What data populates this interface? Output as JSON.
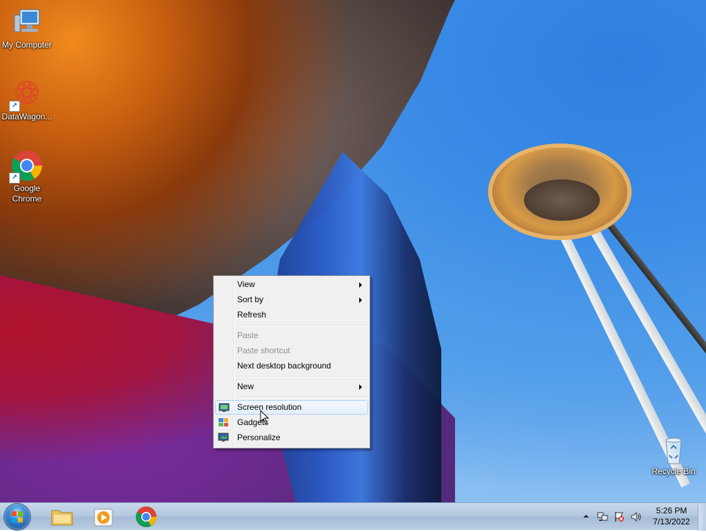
{
  "desktop": {
    "icons": [
      {
        "label": "My Computer",
        "icon": "computer-icon"
      },
      {
        "label": "DataWagon...",
        "icon": "datawagon-icon"
      },
      {
        "label": "Google Chrome",
        "icon": "chrome-icon"
      },
      {
        "label": "Recycle Bin",
        "icon": "recycle-bin-icon"
      }
    ]
  },
  "context_menu": {
    "items": [
      {
        "label": "View",
        "submenu": true,
        "enabled": true
      },
      {
        "label": "Sort by",
        "submenu": true,
        "enabled": true
      },
      {
        "label": "Refresh",
        "submenu": false,
        "enabled": true
      },
      {
        "label": "Paste",
        "submenu": false,
        "enabled": false
      },
      {
        "label": "Paste shortcut",
        "submenu": false,
        "enabled": false
      },
      {
        "label": "Next desktop background",
        "submenu": false,
        "enabled": true
      },
      {
        "label": "New",
        "submenu": true,
        "enabled": true
      },
      {
        "label": "Screen resolution",
        "submenu": false,
        "enabled": true,
        "highlighted": true,
        "icon": "display-icon"
      },
      {
        "label": "Gadgets",
        "submenu": false,
        "enabled": true,
        "icon": "gadgets-icon"
      },
      {
        "label": "Personalize",
        "submenu": false,
        "enabled": true,
        "icon": "personalize-icon"
      }
    ]
  },
  "taskbar": {
    "pinned": [
      {
        "icon": "start-orb-icon"
      },
      {
        "icon": "file-explorer-icon"
      },
      {
        "icon": "media-player-icon"
      },
      {
        "icon": "chrome-icon"
      }
    ],
    "tray": {
      "icons": [
        "show-hidden-icons-chevron",
        "network-icon",
        "action-center-flag-icon",
        "volume-icon"
      ]
    },
    "clock": {
      "time": "5:26 PM",
      "date": "7/13/2022"
    }
  },
  "colors": {
    "menu_background": "#f0f0f0",
    "menu_highlight_border": "#aecff7",
    "taskbar": "#b4c9df"
  }
}
